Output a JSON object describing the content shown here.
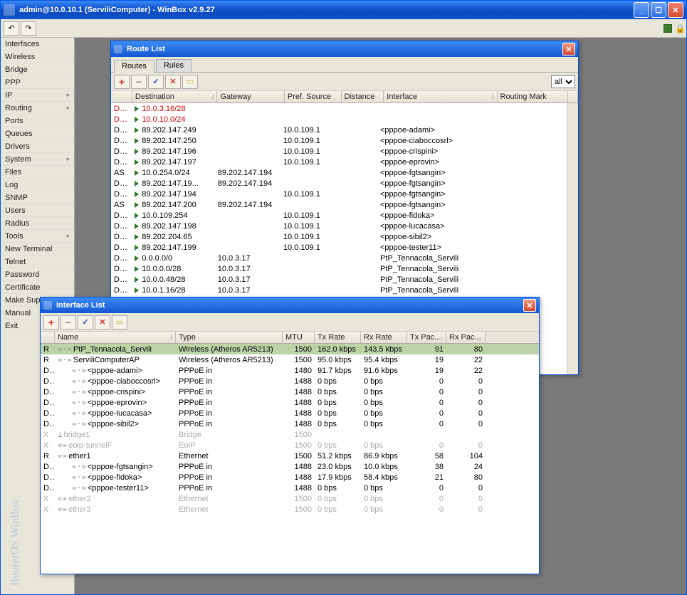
{
  "window": {
    "title": "admin@10.0.10.1 (ServiliComputer) - WinBox v2.9.27",
    "branding": "RouterOS WinBox"
  },
  "toolbar": {
    "undo_glyph": "↶",
    "redo_glyph": "↷"
  },
  "sidebar": {
    "items": [
      {
        "label": "Interfaces",
        "arrow": false
      },
      {
        "label": "Wireless",
        "arrow": false
      },
      {
        "label": "Bridge",
        "arrow": false
      },
      {
        "label": "PPP",
        "arrow": false
      },
      {
        "label": "IP",
        "arrow": true
      },
      {
        "label": "Routing",
        "arrow": true
      },
      {
        "label": "Ports",
        "arrow": false
      },
      {
        "label": "Queues",
        "arrow": false
      },
      {
        "label": "Drivers",
        "arrow": false
      },
      {
        "label": "System",
        "arrow": true
      },
      {
        "label": "Files",
        "arrow": false
      },
      {
        "label": "Log",
        "arrow": false
      },
      {
        "label": "SNMP",
        "arrow": false
      },
      {
        "label": "Users",
        "arrow": false
      },
      {
        "label": "Radius",
        "arrow": false
      },
      {
        "label": "Tools",
        "arrow": true
      },
      {
        "label": "New Terminal",
        "arrow": false
      },
      {
        "label": "Telnet",
        "arrow": false
      },
      {
        "label": "Password",
        "arrow": false
      },
      {
        "label": "Certificate",
        "arrow": false
      },
      {
        "label": "Make Supout.rif",
        "arrow": false
      },
      {
        "label": "Manual",
        "arrow": false
      },
      {
        "label": "Exit",
        "arrow": false
      }
    ]
  },
  "route_list": {
    "title": "Route List",
    "tabs": [
      "Routes",
      "Rules"
    ],
    "active_tab": 0,
    "filter_select": "all",
    "headers": [
      "",
      "Destination",
      "Gateway",
      "Pref. Source",
      "Distance",
      "Interface",
      "Routing Mark",
      ""
    ],
    "rows": [
      {
        "flags": "DI O",
        "dst": "10.0.3.16/28",
        "gw": "",
        "pref": "",
        "dist": "",
        "iface": "",
        "rm": "",
        "red": true
      },
      {
        "flags": "DI O",
        "dst": "10.0.10.0/24",
        "gw": "",
        "pref": "",
        "dist": "",
        "iface": "",
        "rm": "",
        "red": true
      },
      {
        "flags": "DAC",
        "dst": "89.202.147.249",
        "gw": "",
        "pref": "10.0.109.1",
        "dist": "",
        "iface": "<pppoe-adami>",
        "rm": ""
      },
      {
        "flags": "DAC",
        "dst": "89.202.147.250",
        "gw": "",
        "pref": "10.0.109.1",
        "dist": "",
        "iface": "<pppoe-ciaboccosrl>",
        "rm": ""
      },
      {
        "flags": "DAC",
        "dst": "89.202.147.196",
        "gw": "",
        "pref": "10.0.109.1",
        "dist": "",
        "iface": "<pppoe-crispini>",
        "rm": ""
      },
      {
        "flags": "DAC",
        "dst": "89.202.147.197",
        "gw": "",
        "pref": "10.0.109.1",
        "dist": "",
        "iface": "<pppoe-eprovin>",
        "rm": ""
      },
      {
        "flags": "AS",
        "dst": "10.0.254.0/24",
        "gw": "89.202.147.194",
        "pref": "",
        "dist": "",
        "iface": "<pppoe-fgtsangin>",
        "rm": ""
      },
      {
        "flags": "DAC",
        "dst": "89.202.147.19...",
        "gw": "89.202.147.194",
        "pref": "",
        "dist": "",
        "iface": "<pppoe-fgtsangin>",
        "rm": ""
      },
      {
        "flags": "DAC",
        "dst": "89.202.147.194",
        "gw": "",
        "pref": "10.0.109.1",
        "dist": "",
        "iface": "<pppoe-fgtsangin>",
        "rm": ""
      },
      {
        "flags": "AS",
        "dst": "89.202.147.200",
        "gw": "89.202.147.194",
        "pref": "",
        "dist": "",
        "iface": "<pppoe-fgtsangin>",
        "rm": ""
      },
      {
        "flags": "DAC",
        "dst": "10.0.109.254",
        "gw": "",
        "pref": "10.0.109.1",
        "dist": "",
        "iface": "<pppoe-fidoka>",
        "rm": ""
      },
      {
        "flags": "DAC",
        "dst": "89.202.147.198",
        "gw": "",
        "pref": "10.0.109.1",
        "dist": "",
        "iface": "<pppoe-lucacasa>",
        "rm": ""
      },
      {
        "flags": "DAC",
        "dst": "89.202.204.65",
        "gw": "",
        "pref": "10.0.109.1",
        "dist": "",
        "iface": "<pppoe-sibil2>",
        "rm": ""
      },
      {
        "flags": "DAC",
        "dst": "89.202.147.199",
        "gw": "",
        "pref": "10.0.109.1",
        "dist": "",
        "iface": "<pppoe-tester11>",
        "rm": ""
      },
      {
        "flags": "DAO",
        "dst": "0.0.0.0/0",
        "gw": "10.0.3.17",
        "pref": "",
        "dist": "",
        "iface": "PtP_Tennacola_Servili",
        "rm": ""
      },
      {
        "flags": "DAO",
        "dst": "10.0.0.0/28",
        "gw": "10.0.3.17",
        "pref": "",
        "dist": "",
        "iface": "PtP_Tennacola_Servili",
        "rm": ""
      },
      {
        "flags": "DAO",
        "dst": "10.0.0.48/28",
        "gw": "10.0.3.17",
        "pref": "",
        "dist": "",
        "iface": "PtP_Tennacola_Servili",
        "rm": ""
      },
      {
        "flags": "DAO",
        "dst": "10.0.1.16/28",
        "gw": "10.0.3.17",
        "pref": "",
        "dist": "",
        "iface": "PtP_Tennacola_Servili",
        "rm": ""
      }
    ]
  },
  "interface_list": {
    "title": "Interface List",
    "headers": [
      "",
      "Name",
      "Type",
      "MTU",
      "Tx Rate",
      "Rx Rate",
      "Tx Pac...",
      "Rx Pac..."
    ],
    "rows": [
      {
        "flags": "R",
        "glyph": "«·»",
        "name": "PtP_Tennacola_Servili",
        "type": "Wireless (Atheros AR5213)",
        "mtu": "1500",
        "tx": "162.0 kbps",
        "rx": "143.5 kbps",
        "txp": "91",
        "rxp": "80",
        "sel": true
      },
      {
        "flags": "R",
        "glyph": "«·»",
        "name": "ServiliComputerAP",
        "type": "Wireless (Atheros AR5213)",
        "mtu": "1500",
        "tx": "95.0 kbps",
        "rx": "95.4 kbps",
        "txp": "19",
        "rxp": "22"
      },
      {
        "flags": "DR",
        "glyph": "«·»",
        "indent": true,
        "name": "<pppoe-adami>",
        "type": "PPPoE in",
        "mtu": "1480",
        "tx": "91.7 kbps",
        "rx": "91.6 kbps",
        "txp": "19",
        "rxp": "22"
      },
      {
        "flags": "DR",
        "glyph": "«·»",
        "indent": true,
        "name": "<pppoe-ciaboccosrl>",
        "type": "PPPoE in",
        "mtu": "1488",
        "tx": "0 bps",
        "rx": "0 bps",
        "txp": "0",
        "rxp": "0"
      },
      {
        "flags": "DR",
        "glyph": "«·»",
        "indent": true,
        "name": "<pppoe-crispini>",
        "type": "PPPoE in",
        "mtu": "1488",
        "tx": "0 bps",
        "rx": "0 bps",
        "txp": "0",
        "rxp": "0"
      },
      {
        "flags": "DR",
        "glyph": "«·»",
        "indent": true,
        "name": "<pppoe-eprovin>",
        "type": "PPPoE in",
        "mtu": "1488",
        "tx": "0 bps",
        "rx": "0 bps",
        "txp": "0",
        "rxp": "0"
      },
      {
        "flags": "DR",
        "glyph": "«·»",
        "indent": true,
        "name": "<pppoe-lucacasa>",
        "type": "PPPoE in",
        "mtu": "1488",
        "tx": "0 bps",
        "rx": "0 bps",
        "txp": "0",
        "rxp": "0"
      },
      {
        "flags": "DR",
        "glyph": "«·»",
        "indent": true,
        "name": "<pppoe-sibil2>",
        "type": "PPPoE in",
        "mtu": "1488",
        "tx": "0 bps",
        "rx": "0 bps",
        "txp": "0",
        "rxp": "0"
      },
      {
        "flags": "X",
        "glyph": "⊥",
        "name": "bridge1",
        "type": "Bridge",
        "mtu": "1500",
        "tx": "",
        "rx": "",
        "txp": "",
        "rxp": "",
        "grey": true
      },
      {
        "flags": "X",
        "glyph": "«»",
        "name": "eoip-tunnelF",
        "type": "EoIP",
        "mtu": "1500",
        "tx": "0 bps",
        "rx": "0 bps",
        "txp": "0",
        "rxp": "0",
        "grey": true
      },
      {
        "flags": "R",
        "glyph": "«»",
        "name": "ether1",
        "type": "Ethernet",
        "mtu": "1500",
        "tx": "51.2 kbps",
        "rx": "86.9 kbps",
        "txp": "58",
        "rxp": "104"
      },
      {
        "flags": "DR",
        "glyph": "«·»",
        "indent": true,
        "name": "<pppoe-fgtsangin>",
        "type": "PPPoE in",
        "mtu": "1488",
        "tx": "23.0 kbps",
        "rx": "10.0 kbps",
        "txp": "38",
        "rxp": "24"
      },
      {
        "flags": "DR",
        "glyph": "«·»",
        "indent": true,
        "name": "<pppoe-fidoka>",
        "type": "PPPoE in",
        "mtu": "1488",
        "tx": "17.9 kbps",
        "rx": "58.4 kbps",
        "txp": "21",
        "rxp": "80"
      },
      {
        "flags": "DR",
        "glyph": "«·»",
        "indent": true,
        "name": "<pppoe-tester11>",
        "type": "PPPoE in",
        "mtu": "1488",
        "tx": "0 bps",
        "rx": "0 bps",
        "txp": "0",
        "rxp": "0"
      },
      {
        "flags": "X",
        "glyph": "«»",
        "name": "ether2",
        "type": "Ethernet",
        "mtu": "1500",
        "tx": "0 bps",
        "rx": "0 bps",
        "txp": "0",
        "rxp": "0",
        "grey": true
      },
      {
        "flags": "X",
        "glyph": "«»",
        "name": "ether3",
        "type": "Ethernet",
        "mtu": "1500",
        "tx": "0 bps",
        "rx": "0 bps",
        "txp": "0",
        "rxp": "0",
        "grey": true
      }
    ]
  }
}
